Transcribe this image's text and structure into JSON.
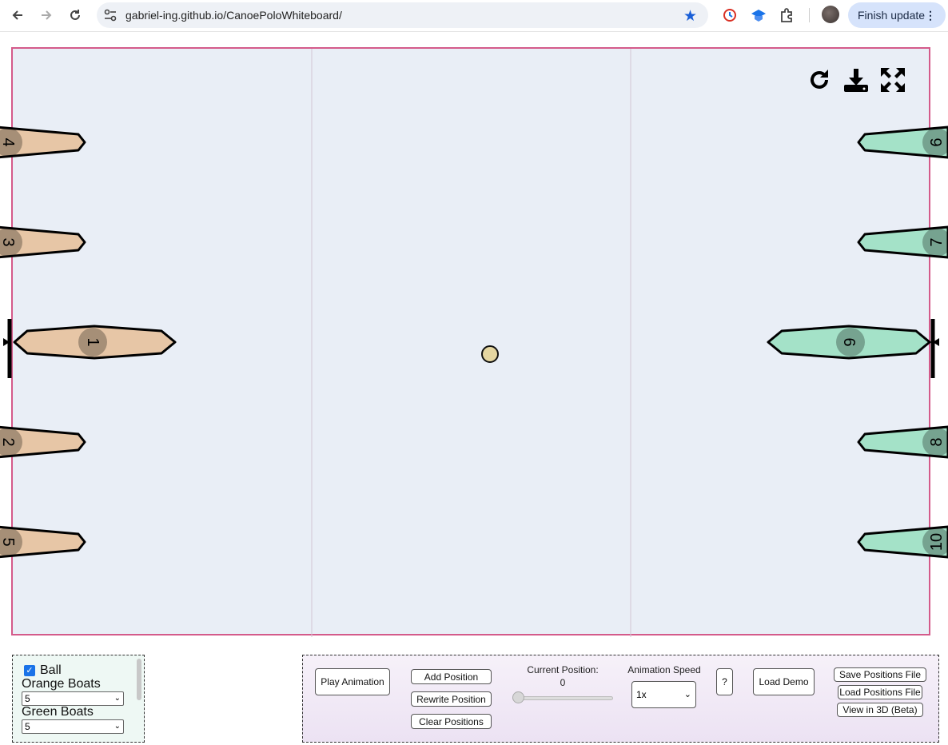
{
  "browser": {
    "url": "gabriel-ing.github.io/CanoePoloWhiteboard/",
    "finish_update_label": "Finish update"
  },
  "field": {
    "tools": [
      "reset-icon",
      "download-icon",
      "fullscreen-icon"
    ],
    "ball_color": "#e5d6a1",
    "orange_color": "#e7c6a6",
    "green_color": "#a4e2c8",
    "orange_boats": [
      "4",
      "3",
      "1",
      "2",
      "5"
    ],
    "green_boats": [
      "6",
      "7",
      "9",
      "8",
      "10"
    ]
  },
  "left_panel": {
    "ball_label": "Ball",
    "ball_checked": true,
    "orange_label": "Orange Boats",
    "orange_value": "5",
    "green_label": "Green Boats",
    "green_value": "5"
  },
  "controls": {
    "play_animation": "Play Animation",
    "add_position": "Add Position",
    "rewrite_position": "Rewrite Position",
    "clear_positions": "Clear Positions",
    "current_position_label": "Current Position:",
    "current_position_value": "0",
    "animation_speed_label": "Animation Speed",
    "animation_speed_value": "1x",
    "help": "?",
    "load_demo": "Load Demo",
    "save_positions_file": "Save Positions File",
    "load_positions_file": "Load Positions File",
    "view_3d": "View in 3D (Beta)"
  }
}
